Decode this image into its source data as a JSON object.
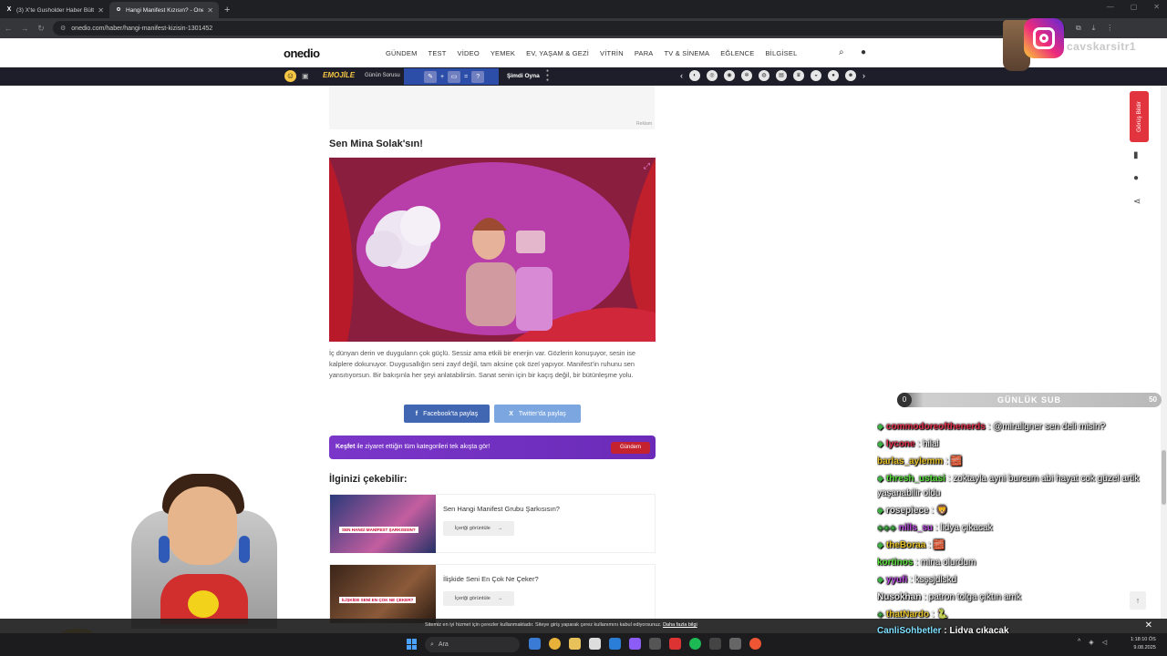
{
  "browser": {
    "tabs": [
      {
        "favicon": "X",
        "title": "(3) X'te Gusholder Haber Bülte...",
        "active": false
      },
      {
        "favicon": "o",
        "title": "Hangi Manifest Kızısın? - Oned...",
        "active": true
      }
    ],
    "url": "onedio.com/haber/hangi-manifest-kizisin-1301452"
  },
  "site": {
    "logo": "onedio",
    "nav": [
      "GÜNDEM",
      "TEST",
      "VİDEO",
      "YEMEK",
      "EV, YAŞAM & GEZİ",
      "VİTRİN",
      "PARA",
      "TV & SİNEMA",
      "EĞLENCE",
      "BİLGİSEL"
    ],
    "promo": {
      "game_name": "EMOJİLE",
      "daily_label": "Günün Sorusu",
      "puzzle_q": "?",
      "play_label": "Şimdi Oyna"
    }
  },
  "article": {
    "ad_label": "Reklam",
    "result_title": "Sen Mina Solak'sın!",
    "description": "İç dünyan derin ve duyguların çok güçlü. Sessiz ama etkili bir enerjin var. Gözlerin konuşuyor, sesin ise kalplere dokunuyor. Duygusallığın seni zayıf değil, tam aksine çok özel yapıyor. Manifest'in ruhunu sen yansıtıyorsun. Bir bakışınla her şeyi anlatabilirsin. Sanat senin için bir kaçış değil, bir bütünleşme yolu.",
    "share_facebook": "Facebook'ta paylaş",
    "share_twitter": "Twitter'da paylaş",
    "kesfet_bold": "Keşfet",
    "kesfet_text": " ile ziyaret ettiğin tüm kategorileri tek akışta gör!",
    "kesfet_chip": "Gündem",
    "related_title": "İlginizi çekebilir:",
    "related": [
      {
        "title": "Sen Hangi Manifest Grubu Şarkısısın?",
        "button": "İçeriği görüntüle",
        "caption": "SEN HANGİ MANİFEST ŞARKISISIN?"
      },
      {
        "title": "İlişkide Seni En Çok Ne Çeker?",
        "button": "İçeriği görüntüle",
        "caption": "İLİŞKİDE SENİ EN ÇOK NE ÇEKER?"
      }
    ]
  },
  "sidebar": {
    "feedback": "Görüş Bildir"
  },
  "overlay": {
    "handle": "cavskarsitr1",
    "sub_goal": {
      "label": "GÜNLÜK SUB",
      "current": "0",
      "max": "50"
    },
    "chat": [
      {
        "user": "commodoreofthenerds",
        "text": ": @mirallgner sen deli misin?",
        "color": "u-red"
      },
      {
        "user": "lycone",
        "text": ": hilal",
        "color": "u-red"
      },
      {
        "user": "barlas_aylemm",
        "text": ": 🧱",
        "color": "u-yellow"
      },
      {
        "user": "thresh_ustasi",
        "text": ": zoktayla ayni burcum abi hayat cok güzel artik yaşanabilir oldu",
        "color": "u-green",
        "wrap": true
      },
      {
        "user": "rosepiece",
        "text": ": 🦁",
        "color": "u-white"
      },
      {
        "user": "nills_su",
        "text": ": lidya çıkacak",
        "color": "u-purple"
      },
      {
        "user": "theBoraa",
        "text": ": 🧱",
        "color": "u-yellow"
      },
      {
        "user": "kortinos",
        "text": ": mina olurdum",
        "color": "u-green"
      },
      {
        "user": "yyufi",
        "text": ": ksşsjdlskd",
        "color": "u-purple"
      },
      {
        "user": "Nusokhan",
        "text": ": patron tolga çıktın amk",
        "color": "u-white"
      },
      {
        "user": "thatNardo",
        "text": ": 🐍",
        "color": "u-yellow"
      }
    ],
    "last_chat": {
      "user": "CanliSohbetler",
      "text": ": Lidya çıkacak"
    }
  },
  "cookie": {
    "text": "Sitemiz en iyi hizmet için çerezler kullanmaktadır. Siteye giriş yaparak çerez kullanımını kabul ediyorsunuz. ",
    "link": "Daha fazla bilgi"
  },
  "taskbar": {
    "search_placeholder": "Ara",
    "time": "1:18:10 ÖS",
    "date": "9.08.2025"
  },
  "colors": {
    "brand_red": "#e2343e",
    "facebook": "#4267b2",
    "twitter": "#7ba6e0",
    "kesfet": "#7a36c9"
  }
}
